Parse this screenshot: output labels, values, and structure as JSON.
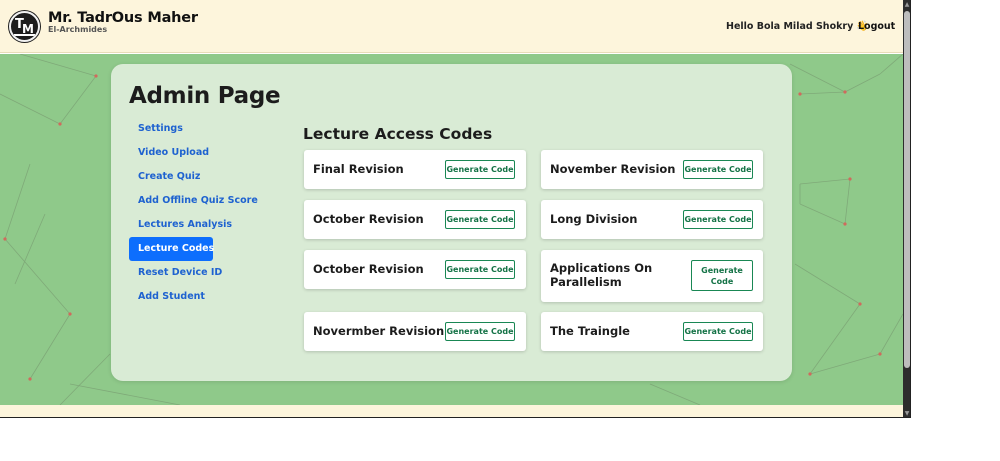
{
  "header": {
    "brand_title": "Mr. TadrOus Maher",
    "brand_subtitle": "El-Archmides",
    "logo_letters": [
      "T",
      "M"
    ],
    "greeting": "Hello Bola Milad Shokry",
    "greeting_icon": "waving-hand-icon",
    "logout_label": "Logout"
  },
  "colors": {
    "header_bg": "#fdf5dc",
    "background_green": "#8fc98a",
    "active_nav": "#0d6efd",
    "link_blue": "#1e62d0",
    "button_green": "#198754"
  },
  "admin": {
    "title": "Admin Page",
    "nav": [
      {
        "label": "Settings",
        "active": false
      },
      {
        "label": "Video Upload",
        "active": false
      },
      {
        "label": "Create Quiz",
        "active": false
      },
      {
        "label": "Add Offline Quiz Score",
        "active": false
      },
      {
        "label": "Lectures Analysis",
        "active": false
      },
      {
        "label": "Lecture Codes",
        "active": true
      },
      {
        "label": "Reset Device ID",
        "active": false
      },
      {
        "label": "Add Student",
        "active": false
      }
    ]
  },
  "codes": {
    "title": "Lecture Access Codes",
    "button_label": "Generate Code",
    "lectures": [
      "Final Revision",
      "November Revision",
      "October Revision",
      "Long Division",
      "October Revision",
      "Applications On Parallelism",
      "Novermber Revision",
      "The Traingle"
    ]
  }
}
